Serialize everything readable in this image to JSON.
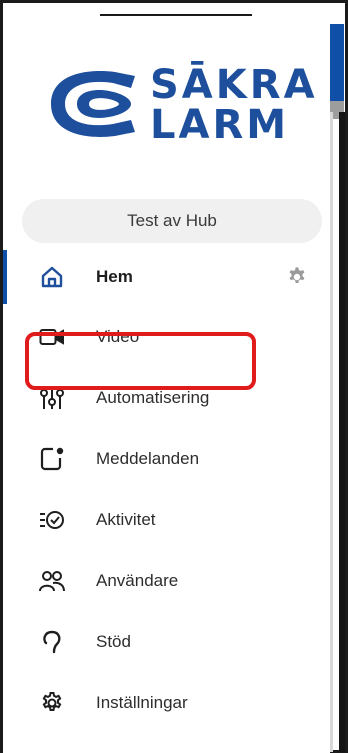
{
  "brand": {
    "line1": "SĀKRA",
    "line2": "LARM",
    "color": "#1d4f9c"
  },
  "hub": {
    "name": "Test av Hub"
  },
  "menu": {
    "items": [
      {
        "label": "Hem",
        "icon": "home-icon",
        "active": true
      },
      {
        "label": "Video",
        "icon": "video-camera-icon"
      },
      {
        "label": "Automatisering",
        "icon": "sliders-icon"
      },
      {
        "label": "Meddelanden",
        "icon": "message-icon"
      },
      {
        "label": "Aktivitet",
        "icon": "activity-icon"
      },
      {
        "label": "Användare",
        "icon": "users-icon"
      },
      {
        "label": "Stöd",
        "icon": "support-icon"
      },
      {
        "label": "Inställningar",
        "icon": "settings-icon"
      }
    ]
  },
  "colors": {
    "accent": "#0f4fa8",
    "highlight": "#e01b1b",
    "icon_gray": "#9a9a9a"
  }
}
